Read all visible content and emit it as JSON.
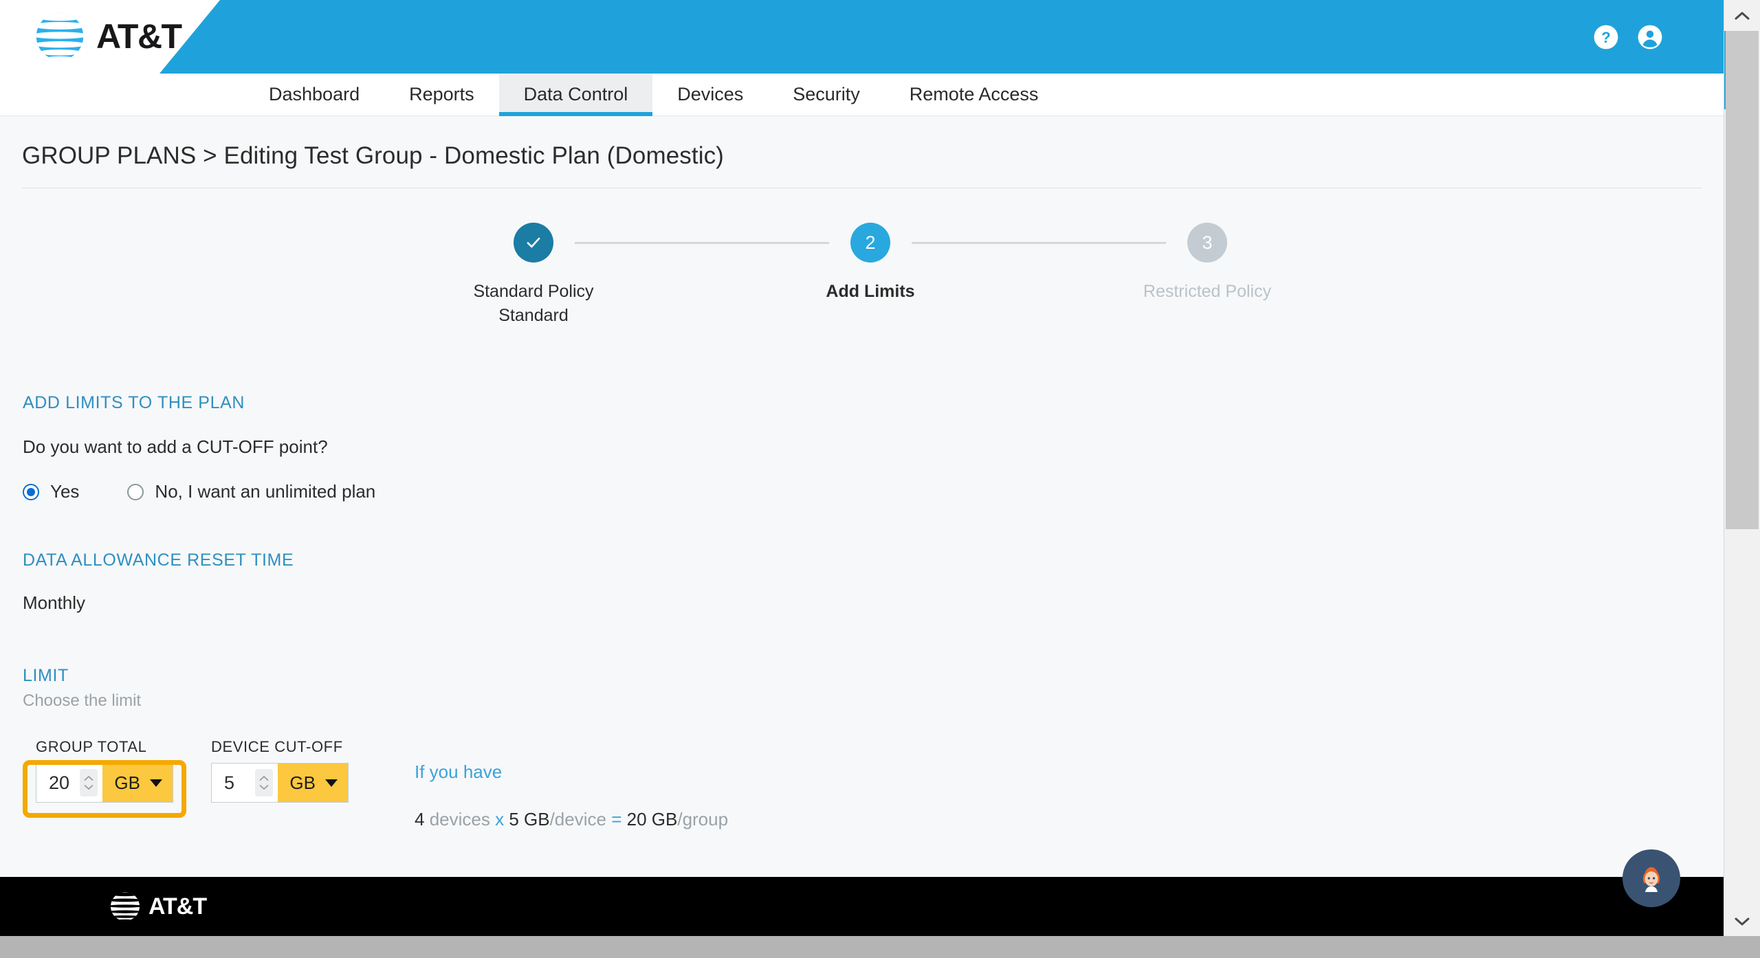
{
  "header": {
    "brand": "AT&T",
    "brand_icon": "att-globe-icon",
    "help_icon": "help-circle-icon",
    "account_icon": "account-circle-icon",
    "background_color": "#1fa2db"
  },
  "nav": {
    "items": [
      {
        "label": "Dashboard",
        "active": false
      },
      {
        "label": "Reports",
        "active": false
      },
      {
        "label": "Data Control",
        "active": true
      },
      {
        "label": "Devices",
        "active": false
      },
      {
        "label": "Security",
        "active": false
      },
      {
        "label": "Remote Access",
        "active": false
      }
    ],
    "active_accent": "#1fa2db"
  },
  "page": {
    "title": "GROUP PLANS > Editing Test Group - Domestic Plan (Domestic)"
  },
  "stepper": {
    "steps": [
      {
        "indicator": "check",
        "state": "done",
        "label_line1": "Standard Policy",
        "label_line2": "Standard",
        "color": "#1b7ca4"
      },
      {
        "indicator": "2",
        "state": "current",
        "label_line1": "Add Limits",
        "label_line2": "",
        "color": "#29a8e0"
      },
      {
        "indicator": "3",
        "state": "todo",
        "label_line1": "Restricted Policy",
        "label_line2": "",
        "color": "#c2ccd2"
      }
    ]
  },
  "form": {
    "add_limits_heading": "ADD LIMITS TO THE PLAN",
    "cutoff_question": "Do you want to add a CUT-OFF point?",
    "cutoff_options": [
      {
        "label": "Yes",
        "selected": true
      },
      {
        "label": "No, I want an unlimited plan",
        "selected": false
      }
    ],
    "reset_time_heading": "DATA ALLOWANCE RESET TIME",
    "reset_time_value": "Monthly",
    "limit_heading": "LIMIT",
    "limit_subtext": "Choose the limit",
    "group_total": {
      "label": "GROUP TOTAL",
      "value": "20",
      "unit": "GB",
      "highlighted": true,
      "highlight_color": "#f5a800"
    },
    "device_cutoff": {
      "label": "DEVICE CUT-OFF",
      "value": "5",
      "unit": "GB",
      "highlighted": false
    },
    "unit_button_color": "#fbc83f"
  },
  "calculation": {
    "title": "If you have",
    "device_count": "4",
    "devices_word": "devices",
    "times": "x",
    "per_device_amount": "5 GB",
    "per_device_word": "/device",
    "equals": "=",
    "total_amount": "20 GB",
    "group_word": "/group"
  },
  "footer": {
    "brand": "AT&T",
    "brand_icon": "att-globe-icon"
  },
  "chat": {
    "icon": "chat-assistant-avatar-icon"
  },
  "scrollbar": {
    "up_icon": "chevron-up-icon",
    "down_icon": "chevron-down-icon"
  }
}
